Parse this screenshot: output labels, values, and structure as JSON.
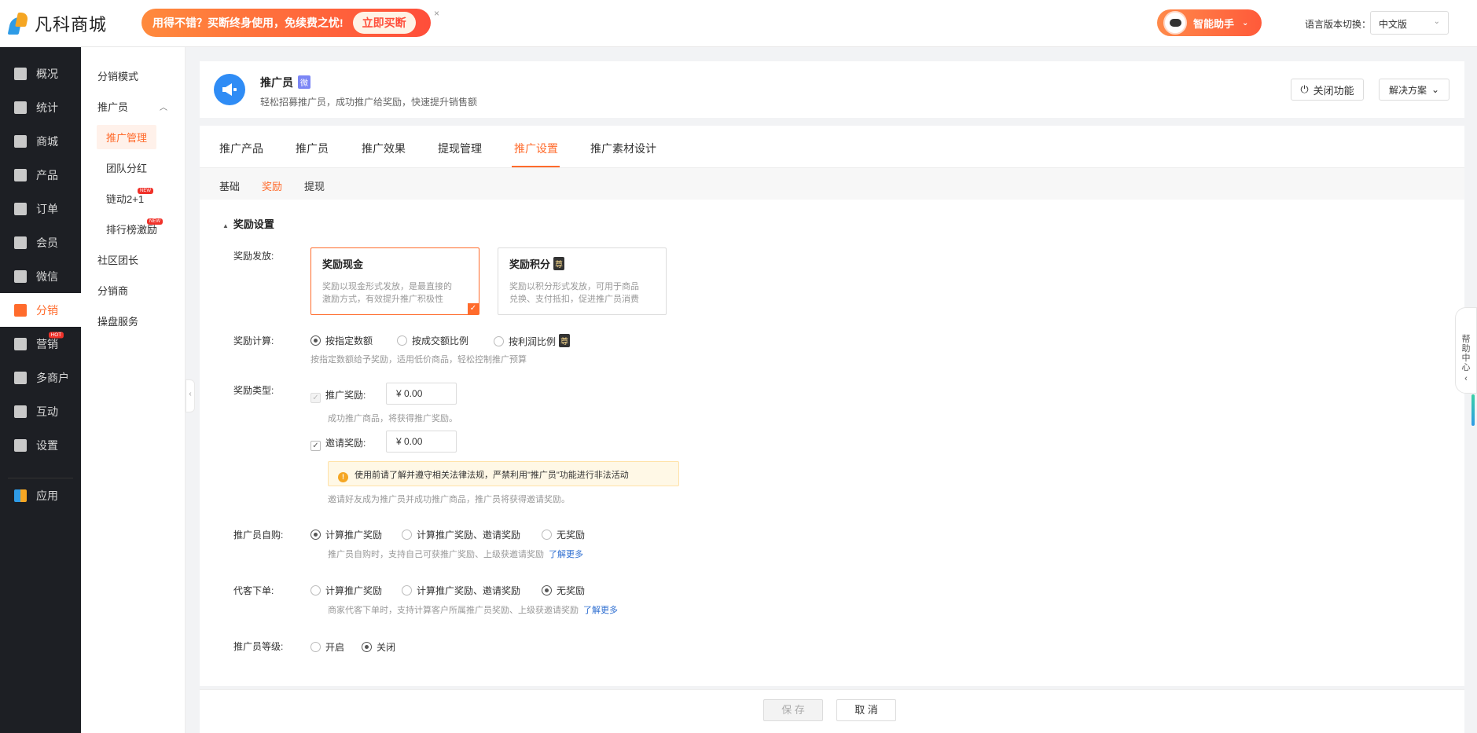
{
  "topbar": {
    "logo_text": "凡科商城",
    "promo_text": "用得不错？买断终身使用，免续费之忧!",
    "promo_button": "立即买断",
    "promo_close": "×",
    "assistant_label": "智能助手",
    "lang_label": "语言版本切换：",
    "lang_value": "中文版"
  },
  "sidebar": {
    "items": [
      {
        "label": "概况",
        "icon": "layers-icon"
      },
      {
        "label": "统计",
        "icon": "chart-icon"
      },
      {
        "label": "商城",
        "icon": "mail-icon"
      },
      {
        "label": "产品",
        "icon": "grid-icon"
      },
      {
        "label": "订单",
        "icon": "clipboard-icon"
      },
      {
        "label": "会员",
        "icon": "crown-icon"
      },
      {
        "label": "微信",
        "icon": "wechat-icon"
      },
      {
        "label": "分销",
        "icon": "user-share-icon"
      },
      {
        "label": "营销",
        "icon": "flag-icon",
        "badge": "HOT"
      },
      {
        "label": "多商户",
        "icon": "store-icon"
      },
      {
        "label": "互动",
        "icon": "interact-icon"
      },
      {
        "label": "设置",
        "icon": "gear-icon"
      },
      {
        "label": "应用",
        "icon": "apps-icon"
      }
    ]
  },
  "submenu": {
    "items": [
      {
        "label": "分销模式"
      },
      {
        "label": "推广员"
      },
      {
        "label": "推广管理"
      },
      {
        "label": "团队分红"
      },
      {
        "label": "链动2+1",
        "badge": "NEW"
      },
      {
        "label": "排行榜激励",
        "badge": "NEW"
      },
      {
        "label": "社区团长"
      },
      {
        "label": "分销商"
      },
      {
        "label": "操盘服务"
      }
    ],
    "collapse": "‹"
  },
  "header": {
    "title": "推广员",
    "title_badge": "微",
    "desc": "轻松招募推广员，成功推广给奖励，快速提升销售额",
    "close_button": "关闭功能",
    "solution_button": "解决方案"
  },
  "tabs": [
    "推广产品",
    "推广员",
    "推广效果",
    "提现管理",
    "推广设置",
    "推广素材设计"
  ],
  "subtabs": [
    "基础",
    "奖励",
    "提现"
  ],
  "form": {
    "section_title": "奖励设置",
    "reward_issue": {
      "label": "奖励发放:",
      "cash": {
        "title": "奖励现金",
        "desc1": "奖励以现金形式发放，是最直接的",
        "desc2": "激励方式，有效提升推广积极性"
      },
      "points": {
        "title": "奖励积分",
        "badge": "尊",
        "desc1": "奖励以积分形式发放，可用于商品",
        "desc2": "兑换、支付抵扣，促进推广员消费"
      }
    },
    "reward_calc": {
      "label": "奖励计算:",
      "options": [
        "按指定数额",
        "按成交额比例",
        "按利润比例"
      ],
      "badge": "尊",
      "hint": "按指定数额给予奖励，适用低价商品，轻松控制推广预算"
    },
    "reward_type": {
      "label": "奖励类型:",
      "promo_label": "推广奖励:",
      "promo_value": "¥  0.00",
      "promo_hint": "成功推广商品，将获得推广奖励。",
      "invite_label": "邀请奖励:",
      "invite_value": "¥  0.00",
      "warning": "使用前请了解并遵守相关法律法规，严禁利用\"推广员\"功能进行非法活动",
      "invite_hint": "邀请好友成为推广员并成功推广商品，推广员将获得邀请奖励。"
    },
    "self_buy": {
      "label": "推广员自购:",
      "options": [
        "计算推广奖励",
        "计算推广奖励、邀请奖励",
        "无奖励"
      ],
      "hint": "推广员自购时，支持自己可获推广奖励、上级获邀请奖励",
      "link": "了解更多"
    },
    "proxy_order": {
      "label": "代客下单:",
      "options": [
        "计算推广奖励",
        "计算推广奖励、邀请奖励",
        "无奖励"
      ],
      "hint": "商家代客下单时，支持计算客户所属推广员奖励、上级获邀请奖励",
      "link": "了解更多"
    },
    "level": {
      "label": "推广员等级:",
      "options": [
        "开启",
        "关闭"
      ]
    }
  },
  "footer": {
    "save": "保 存",
    "cancel": "取 消"
  },
  "help": {
    "text": "帮\n助\n中\n心"
  },
  "colors": {
    "accent": "#ff6b2c",
    "sidebar_bg": "#1d1f24",
    "link": "#2f6fd1"
  }
}
